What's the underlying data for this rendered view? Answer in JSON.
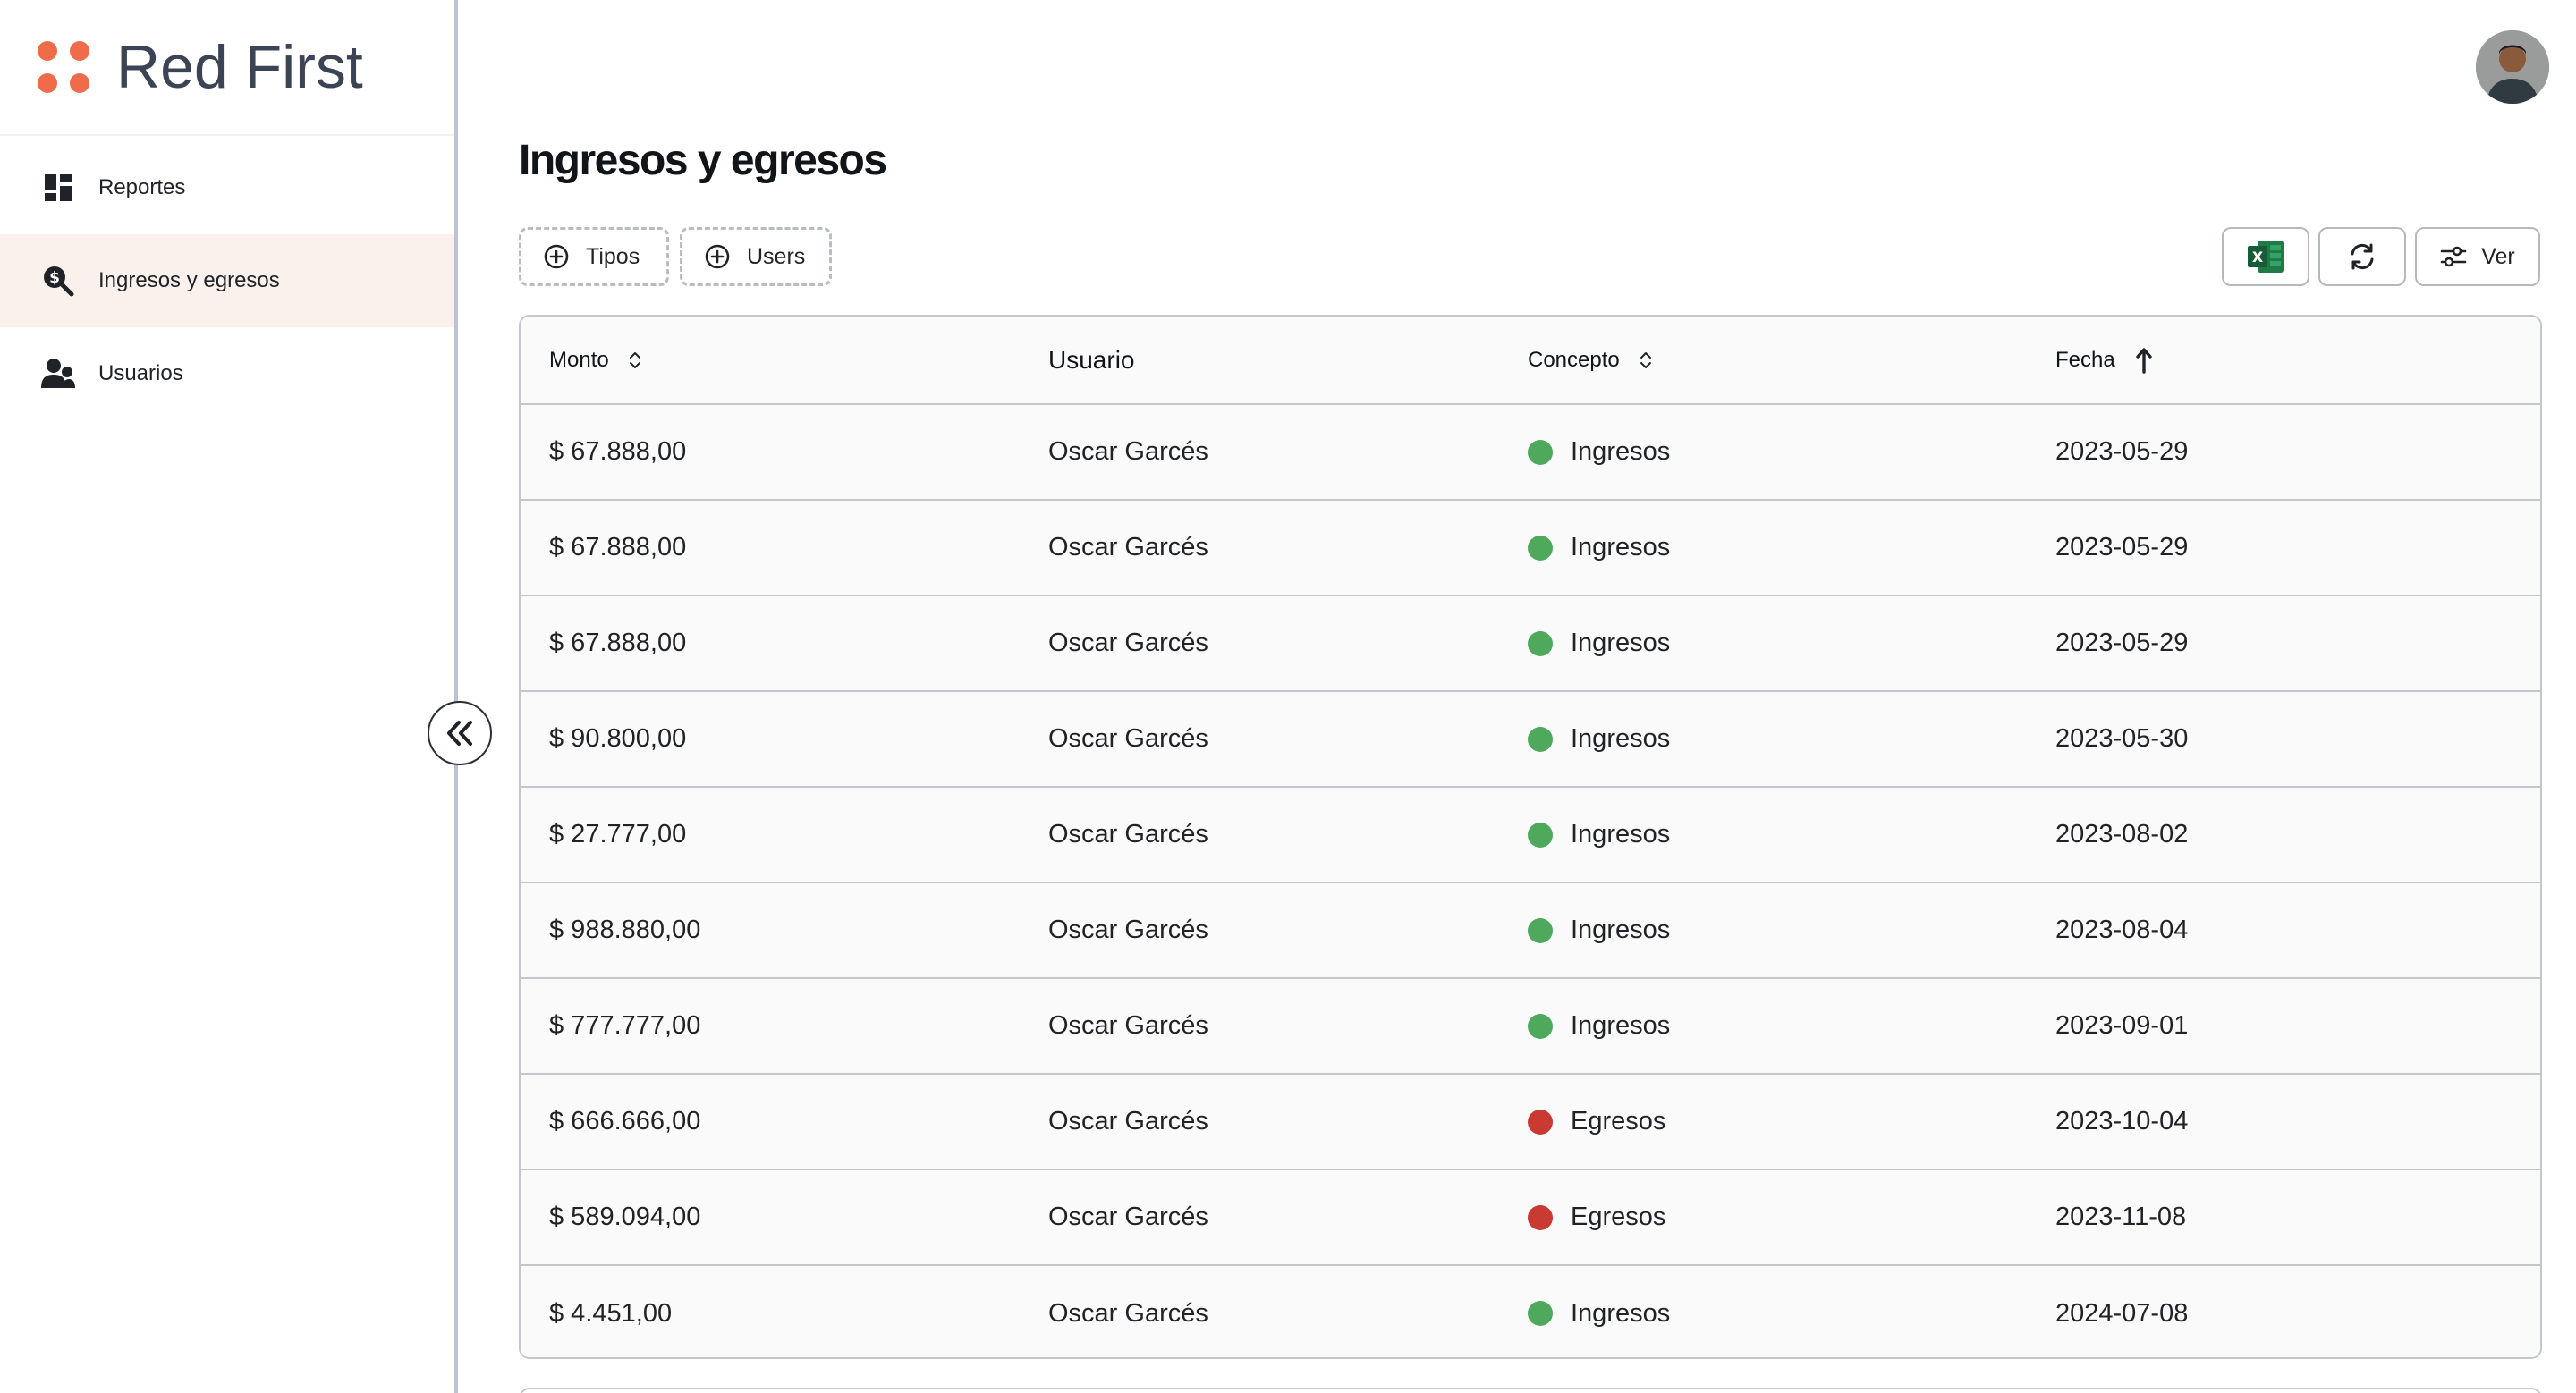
{
  "brand": {
    "name": "Red First",
    "accent": "#ef6b4a"
  },
  "sidebar": {
    "items": [
      {
        "label": "Reportes",
        "icon": "dashboard-icon"
      },
      {
        "label": "Ingresos y egresos",
        "icon": "money-search-icon",
        "active": true
      },
      {
        "label": "Usuarios",
        "icon": "users-icon"
      }
    ]
  },
  "main": {
    "title": "Ingresos y egresos",
    "filters": {
      "tipos": "Tipos",
      "users": "Users"
    },
    "toolbar": {
      "ver": "Ver"
    }
  },
  "table": {
    "columns": {
      "monto": "Monto",
      "usuario": "Usuario",
      "concepto": "Concepto",
      "fecha": "Fecha"
    },
    "rows": [
      {
        "monto": "$ 67.888,00",
        "usuario": "Oscar Garcés",
        "concepto": "Ingresos",
        "fecha": "2023-05-29",
        "status": "green"
      },
      {
        "monto": "$ 67.888,00",
        "usuario": "Oscar Garcés",
        "concepto": "Ingresos",
        "fecha": "2023-05-29",
        "status": "green"
      },
      {
        "monto": "$ 67.888,00",
        "usuario": "Oscar Garcés",
        "concepto": "Ingresos",
        "fecha": "2023-05-29",
        "status": "green"
      },
      {
        "monto": "$ 90.800,00",
        "usuario": "Oscar Garcés",
        "concepto": "Ingresos",
        "fecha": "2023-05-30",
        "status": "green"
      },
      {
        "monto": "$ 27.777,00",
        "usuario": "Oscar Garcés",
        "concepto": "Ingresos",
        "fecha": "2023-08-02",
        "status": "green"
      },
      {
        "monto": "$ 988.880,00",
        "usuario": "Oscar Garcés",
        "concepto": "Ingresos",
        "fecha": "2023-08-04",
        "status": "green"
      },
      {
        "monto": "$ 777.777,00",
        "usuario": "Oscar Garcés",
        "concepto": "Ingresos",
        "fecha": "2023-09-01",
        "status": "green"
      },
      {
        "monto": "$ 666.666,00",
        "usuario": "Oscar Garcés",
        "concepto": "Egresos",
        "fecha": "2023-10-04",
        "status": "red"
      },
      {
        "monto": "$ 589.094,00",
        "usuario": "Oscar Garcés",
        "concepto": "Egresos",
        "fecha": "2023-11-08",
        "status": "red"
      },
      {
        "monto": "$ 4.451,00",
        "usuario": "Oscar Garcés",
        "concepto": "Ingresos",
        "fecha": "2024-07-08",
        "status": "green"
      }
    ]
  },
  "colors": {
    "green": "#4fa95d",
    "red": "#c93a33"
  }
}
